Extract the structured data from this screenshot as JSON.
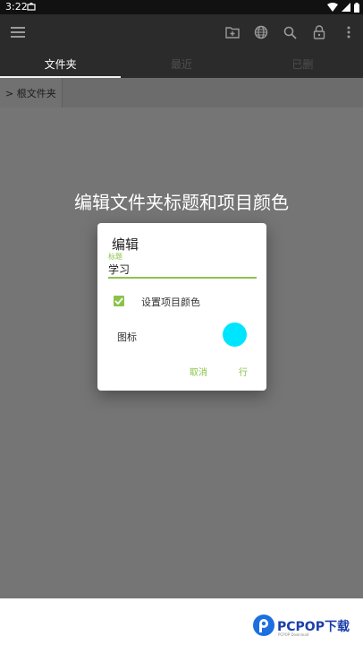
{
  "status_bar": {
    "time": "3:22"
  },
  "tabs": [
    {
      "label": "文件夹"
    },
    {
      "label": "最近"
    },
    {
      "label": "已删"
    }
  ],
  "breadcrumb": {
    "label": "> 根文件夹"
  },
  "overlay_title": "编辑文件夹标题和项目颜色",
  "dialog": {
    "title": "编辑",
    "field_label": "标题",
    "field_value": "学习",
    "checkbox_label": "设置项目颜色",
    "checkbox_checked": true,
    "icon_label": "图标",
    "color": "#00e5ff",
    "cancel_label": "取消",
    "ok_label": "行"
  },
  "watermark": {
    "text": "PCPOP下载",
    "sub": "PCPOP Download"
  },
  "colors": {
    "accent": "#8bc34a",
    "app_bar": "#2b2b2b",
    "scrim": "#757575"
  }
}
